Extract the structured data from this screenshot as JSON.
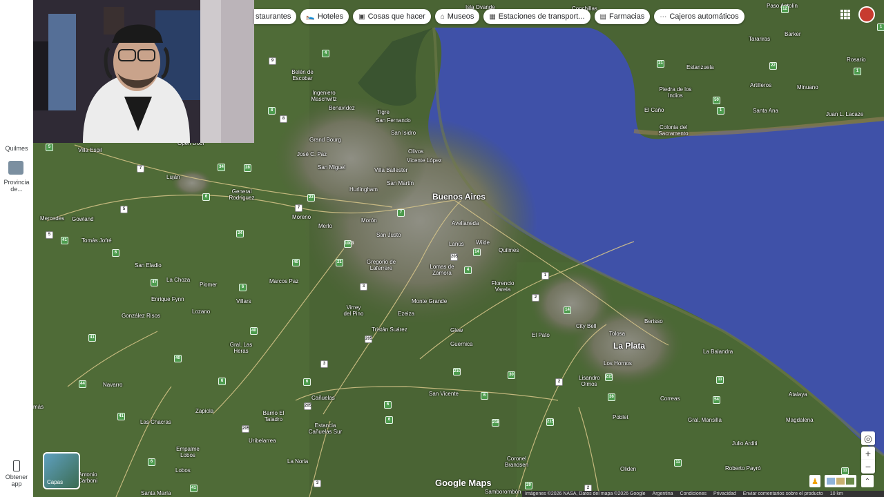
{
  "chips": [
    {
      "icon": "restaurant-icon",
      "label": "staurantes"
    },
    {
      "icon": "hotel-icon",
      "label": "Hoteles"
    },
    {
      "icon": "camera-icon",
      "label": "Cosas que hacer"
    },
    {
      "icon": "museum-icon",
      "label": "Museos"
    },
    {
      "icon": "transit-icon",
      "label": "Estaciones de transport..."
    },
    {
      "icon": "pharmacy-icon",
      "label": "Farmacias"
    },
    {
      "icon": "atm-icon",
      "label": "Cajeros automáticos"
    }
  ],
  "sidebar": {
    "recent_1": "Quilmes",
    "recent_2": "Provincia de...",
    "get_app": "Obtener app"
  },
  "layers_label": "Capas",
  "logo": "Google Maps",
  "attribution": {
    "imagery": "Imágenes ©2026 NASA, Datos del mapa ©2026 Google",
    "country": "Argentina",
    "terms": "Condiciones",
    "privacy": "Privacidad",
    "feedback": "Enviar comentarios sobre el producto",
    "scale": "10 km"
  },
  "places": {
    "buenos_aires": "Buenos Aires",
    "la_plata": "La Plata",
    "isla_ovande": "Isla Ovande",
    "paso_antolin": "Paso Antolín",
    "conchillas": "Conchillas",
    "barker": "Barker",
    "tarariras": "Tarariras",
    "rosario": "Rosario",
    "estanzuela": "Estanzuela",
    "artilleros": "Artilleros",
    "minuano": "Minuano",
    "piedra_indios": "Piedra de los Indios",
    "el_cano": "El Caño",
    "santa_ana": "Santa Ana",
    "juan_lacaze": "Juan L. Lacaze",
    "colonia": "Colonia del Sacramento",
    "belen": "Belén de Escobar",
    "ingeniero": "Ingeniero Maschwitz",
    "benavidez": "Benavídez",
    "tigre": "Tigre",
    "san_fernando": "San Fernando",
    "san_isidro": "San Isidro",
    "grand_bourg": "Grand Bourg",
    "olivos": "Olivos",
    "vicente_lopez": "Vicente López",
    "jose_c_paz": "José C. Paz",
    "san_miguel": "San Miguel",
    "villa_ballester": "Villa Ballester",
    "san_martin": "San Martín",
    "hurlingham": "Hurlingham",
    "villa_espil": "Villa Espil",
    "open_door": "Open Door",
    "lujan": "Luján",
    "general_rodriguez": "General Rodríguez",
    "moreno": "Moreno",
    "merlo": "Merlo",
    "moron": "Morón",
    "avellaneda": "Avellaneda",
    "san_justo": "San Justo",
    "lanus": "Lanús",
    "wilde": "Wilde",
    "quilmes": "Quilmes",
    "mercedes": "Mercedes",
    "gowland": "Gowland",
    "tomas_jofre": "Tomás Jofré",
    "gregorio": "Gregorio de Laferrere",
    "lomas": "Lomas de Zamora",
    "san_eladio": "San Eladio",
    "la_choza": "La Choza",
    "plomer": "Plomer",
    "marcos_paz": "Marcos Paz",
    "florencio_varela": "Florencio Varela",
    "enrique_fynn": "Enrique Fynn",
    "villars": "Villars",
    "monte_grande": "Monte Grande",
    "gonzalez_risos": "González Risos",
    "lozano": "Lozano",
    "virrey": "Virrey del Pino",
    "ezeiza": "Ezeiza",
    "berisso": "Berisso",
    "tristan_suarez": "Tristán Suárez",
    "glew": "Glew",
    "city_bell": "City Bell",
    "el_pato": "El Pato",
    "tolosa": "Tolosa",
    "guernica": "Guernica",
    "gral_las_heras": "Gral. Las Heras",
    "la_balandra": "La Balandra",
    "los_hornos": "Los Hornos",
    "navarro": "Navarro",
    "lisandro_olmos": "Lisandro Olmos",
    "atalaya": "Atalaya",
    "canuelas": "Cañuelas",
    "san_vicente": "San Vicente",
    "correas": "Correas",
    "magdalena": "Magdalena",
    "zapiola": "Zapiola",
    "poblet": "Poblet",
    "barrio_talado": "Barrio El Taladro",
    "gral_mansilla": "Gral. Mansilla",
    "las_chacras": "Las Chacras",
    "estancia": "Estancia Cañuelas Sur",
    "uribelarrea": "Uribelarrea",
    "julio_arditi": "Julio Arditi",
    "empalme": "Empalme Lobos",
    "la_noria": "La Noria",
    "coronel_brandsen": "Coronel Brandsen",
    "roberto_payro": "Roberto Payró",
    "lobos": "Lobos",
    "antonio_carboni": "Antonio Carboni",
    "oliden": "Oliden",
    "santa_maria": "Santa María",
    "samborombon": "Samborombón",
    "mas": "más"
  }
}
